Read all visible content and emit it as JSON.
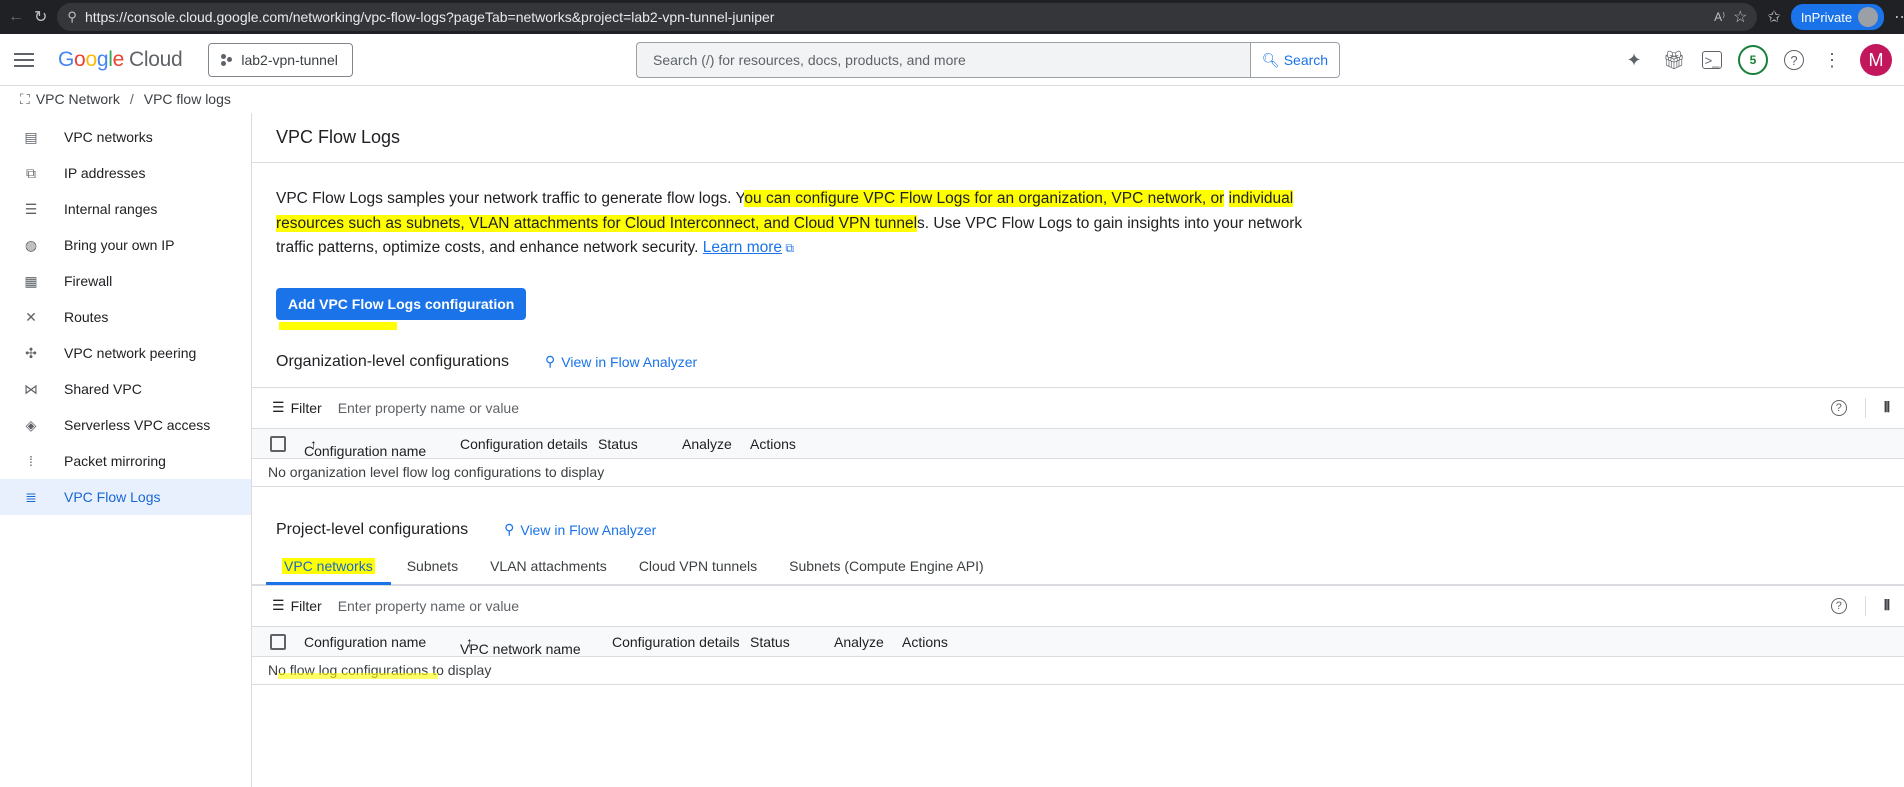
{
  "browser": {
    "url": "https://console.cloud.google.com/networking/vpc-flow-logs?pageTab=networks&project=lab2-vpn-tunnel-juniper",
    "inprivate_label": "InPrivate"
  },
  "header": {
    "logo_g": "G",
    "logo_o1": "o",
    "logo_o2": "o",
    "logo_g2": "g",
    "logo_l": "l",
    "logo_e": "e",
    "logo_cloud": "Cloud",
    "project": "lab2-vpn-tunnel",
    "search_placeholder": "Search (/) for resources, docs, products, and more",
    "search_button": "Search",
    "notification_count": "5",
    "avatar_initial": "M"
  },
  "breadcrumb": {
    "root": "VPC Network",
    "separator": "/",
    "current": "VPC flow logs"
  },
  "sidebar": {
    "items": [
      {
        "label": "VPC networks",
        "icon": "vpc-networks-icon",
        "glyph": "▤"
      },
      {
        "label": "IP addresses",
        "icon": "ip-addresses-icon",
        "glyph": "⧉"
      },
      {
        "label": "Internal ranges",
        "icon": "internal-ranges-icon",
        "glyph": "☰"
      },
      {
        "label": "Bring your own IP",
        "icon": "globe-icon",
        "glyph": "◍"
      },
      {
        "label": "Firewall",
        "icon": "firewall-icon",
        "glyph": "▦"
      },
      {
        "label": "Routes",
        "icon": "routes-icon",
        "glyph": "✕"
      },
      {
        "label": "VPC network peering",
        "icon": "peering-icon",
        "glyph": "✣"
      },
      {
        "label": "Shared VPC",
        "icon": "shared-vpc-icon",
        "glyph": "⋈"
      },
      {
        "label": "Serverless VPC access",
        "icon": "serverless-icon",
        "glyph": "◈"
      },
      {
        "label": "Packet mirroring",
        "icon": "packet-mirroring-icon",
        "glyph": "⁞"
      },
      {
        "label": "VPC Flow Logs",
        "icon": "flow-logs-icon",
        "glyph": "≣"
      }
    ],
    "active_index": 10
  },
  "page": {
    "title": "VPC Flow Logs",
    "desc_part1": "VPC Flow Logs samples your network traffic to generate flow logs. Y",
    "desc_highlight1": "ou can configure VPC Flow Logs for an organization, VPC network, or",
    "desc_highlight2": "individual resources such as subnets, VLAN attachments for Cloud Interconnect, and Cloud VPN tunnel",
    "desc_part2": "s. Use VPC Flow Logs to gain insights into your network traffic patterns, optimize costs, and enhance network security.",
    "learn_more": "Learn more",
    "add_button": "Add VPC Flow Logs configuration",
    "highlight_color": "#ffff00",
    "accent_color": "#1a73e8"
  },
  "org_section": {
    "title": "Organization-level configurations",
    "analyzer_link": "View in Flow Analyzer",
    "filter_label": "Filter",
    "filter_placeholder": "Enter property name or value",
    "columns": [
      "Configuration name",
      "Configuration details",
      "Status",
      "Analyze",
      "Actions"
    ],
    "sort_arrow": "↑",
    "empty_text": "No organization level flow log configurations to display"
  },
  "project_section": {
    "title": "Project-level configurations",
    "analyzer_link": "View in Flow Analyzer",
    "tabs": [
      "VPC networks",
      "Subnets",
      "VLAN attachments",
      "Cloud VPN tunnels",
      "Subnets (Compute Engine API)"
    ],
    "active_tab": 0,
    "filter_label": "Filter",
    "filter_placeholder": "Enter property name or value",
    "columns": [
      "Configuration name",
      "VPC network name",
      "Configuration details",
      "Status",
      "Analyze",
      "Actions"
    ],
    "sort_arrow": "↑",
    "empty_text": "No flow log configurations to display"
  }
}
